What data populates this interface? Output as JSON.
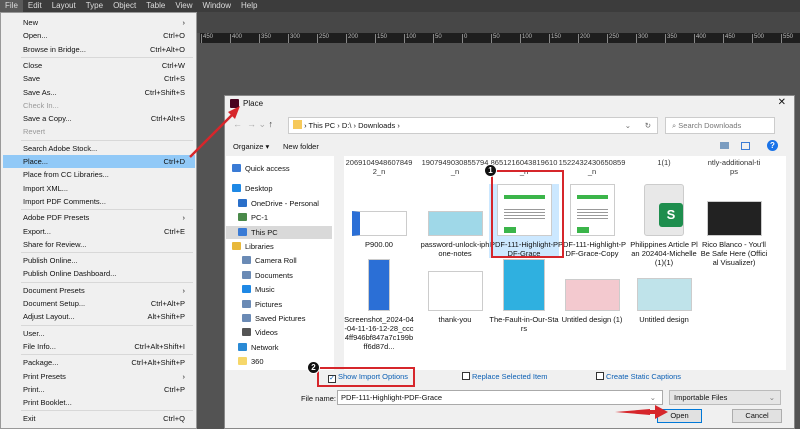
{
  "menubar": [
    "File",
    "Edit",
    "Layout",
    "Type",
    "Object",
    "Table",
    "View",
    "Window",
    "Help"
  ],
  "ruler": [
    "450",
    "400",
    "350",
    "300",
    "250",
    "200",
    "150",
    "100",
    "50",
    "0",
    "50",
    "100",
    "150",
    "200",
    "250",
    "300",
    "350",
    "400",
    "450",
    "500",
    "550"
  ],
  "file_menu": [
    {
      "label": "New",
      "sc": "›"
    },
    {
      "label": "Open...",
      "sc": "Ctrl+O"
    },
    {
      "label": "Browse in Bridge...",
      "sc": "Ctrl+Alt+O"
    },
    {
      "label": "Close",
      "sc": "Ctrl+W"
    },
    {
      "label": "Save",
      "sc": "Ctrl+S"
    },
    {
      "label": "Save As...",
      "sc": "Ctrl+Shift+S"
    },
    {
      "label": "Check In...",
      "sc": ""
    },
    {
      "label": "Save a Copy...",
      "sc": "Ctrl+Alt+S"
    },
    {
      "label": "Revert",
      "sc": ""
    },
    {
      "label": "Search Adobe Stock...",
      "sc": ""
    },
    {
      "label": "Place...",
      "sc": "Ctrl+D"
    },
    {
      "label": "Place from CC Libraries...",
      "sc": ""
    },
    {
      "label": "Import XML...",
      "sc": ""
    },
    {
      "label": "Import PDF Comments...",
      "sc": ""
    },
    {
      "label": "Adobe PDF Presets",
      "sc": "›"
    },
    {
      "label": "Export...",
      "sc": "Ctrl+E"
    },
    {
      "label": "Share for Review...",
      "sc": ""
    },
    {
      "label": "Publish Online...",
      "sc": ""
    },
    {
      "label": "Publish Online Dashboard...",
      "sc": ""
    },
    {
      "label": "Document Presets",
      "sc": "›"
    },
    {
      "label": "Document Setup...",
      "sc": "Ctrl+Alt+P"
    },
    {
      "label": "Adjust Layout...",
      "sc": "Alt+Shift+P"
    },
    {
      "label": "User...",
      "sc": ""
    },
    {
      "label": "File Info...",
      "sc": "Ctrl+Alt+Shift+I"
    },
    {
      "label": "Package...",
      "sc": "Ctrl+Alt+Shift+P"
    },
    {
      "label": "Print Presets",
      "sc": "›"
    },
    {
      "label": "Print...",
      "sc": "Ctrl+P"
    },
    {
      "label": "Print Booklet...",
      "sc": ""
    },
    {
      "label": "Exit",
      "sc": "Ctrl+Q"
    }
  ],
  "dialog": {
    "title": "Place",
    "close": "✕",
    "path": [
      "This PC",
      "D:\\",
      "Downloads"
    ],
    "search_placeholder": "Search Downloads",
    "organize": "Organize ▾",
    "new_folder": "New folder",
    "nav": [
      "Quick access",
      "Desktop",
      "OneDrive - Personal",
      "PC-1",
      "This PC",
      "Libraries",
      "Camera Roll",
      "Documents",
      "Music",
      "Pictures",
      "Saved Pictures",
      "Videos",
      "Network",
      "360"
    ],
    "top_row": [
      "2069104948607849\n2_n",
      "1907949030855794_n",
      "8651216043819610_n",
      "1522432430650859_n",
      "1(1)",
      "ntly-additional-ti\nps"
    ],
    "files": [
      "P900.00",
      "password-unlock-iphone-notes",
      "PDF-111-Highlight-PDF-Grace",
      "PDF-111-Highlight-PDF-Grace-Copy",
      "Philippines Article Plan 202404-Michelle(1)(1)",
      "Rico Blanco - You'll Be Safe Here (Official Visualizer)",
      "Screenshot_2024-04-04-11-16-12-28_ccc4ff946bf847a7c199bff6d87d...",
      "thank-you",
      "The-Fault-in-Our-Stars",
      "Untitled design (1)",
      "Untitled design"
    ],
    "show_import": "Show Import Options",
    "replace": "Replace Selected Item",
    "captions": "Create Static Captions",
    "filename_label": "File name:",
    "filename": "PDF-111-Highlight-PDF-Grace",
    "filetype": "Importable Files",
    "open": "Open",
    "cancel": "Cancel"
  },
  "callouts": [
    "1",
    "2"
  ],
  "colors": {
    "highlight": "#91c9f7",
    "annotation": "#d6262b"
  }
}
